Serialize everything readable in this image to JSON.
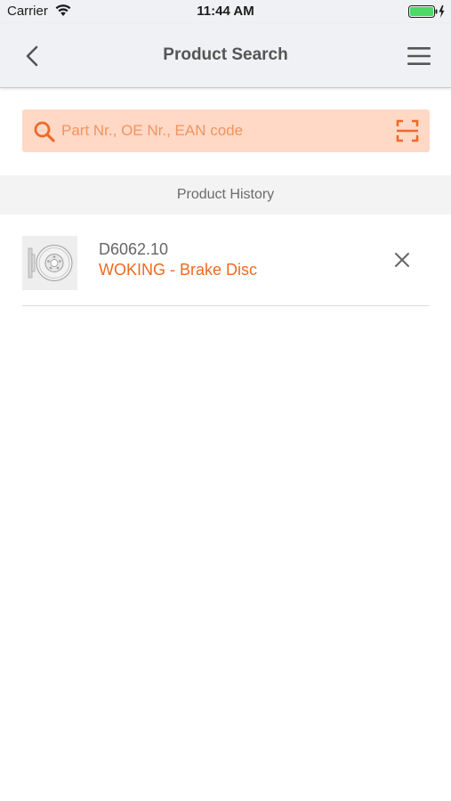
{
  "status_bar": {
    "carrier": "Carrier",
    "time": "11:44 AM",
    "wifi_icon": "wifi-icon",
    "battery_icon": "battery-charging-icon",
    "battery_color": "#4cd964"
  },
  "nav": {
    "title": "Product Search",
    "back_icon": "chevron-left-icon",
    "menu_icon": "hamburger-menu-icon"
  },
  "search": {
    "placeholder": "Part Nr., OE Nr., EAN code",
    "value": "",
    "search_icon": "search-icon",
    "scan_icon": "barcode-scan-icon",
    "accent_color": "#ee6a2c",
    "background_color": "#ffd8c6"
  },
  "history": {
    "header": "Product History",
    "items": [
      {
        "number": "D6062.10",
        "name": "WOKING - Brake Disc",
        "thumbnail_icon": "brake-disc-thumbnail",
        "remove_icon": "close-icon"
      }
    ]
  }
}
